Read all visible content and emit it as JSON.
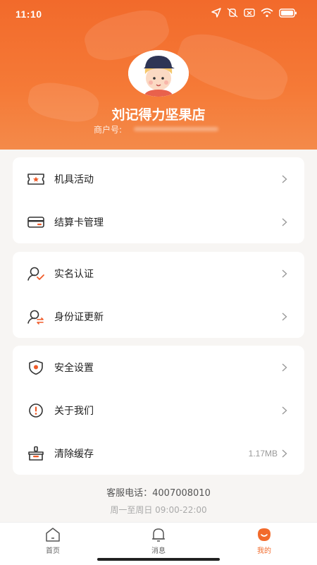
{
  "status_bar": {
    "time": "11:10",
    "icons": [
      "location-icon",
      "mute-icon",
      "sim-off-icon",
      "wifi-icon",
      "battery-icon"
    ]
  },
  "profile": {
    "name": "刘记得力坚果店",
    "merchant_id_label": "商户号:"
  },
  "menu_groups": [
    {
      "items": [
        {
          "label": "机具活动",
          "icon": "ticket-icon"
        },
        {
          "label": "结算卡管理",
          "icon": "card-icon"
        }
      ]
    },
    {
      "items": [
        {
          "label": "实名认证",
          "icon": "user-verify-icon"
        },
        {
          "label": "身份证更新",
          "icon": "user-update-icon"
        }
      ]
    },
    {
      "items": [
        {
          "label": "安全设置",
          "icon": "shield-icon"
        },
        {
          "label": "关于我们",
          "icon": "info-icon"
        },
        {
          "label": "清除缓存",
          "icon": "broom-icon",
          "value": "1.17MB"
        }
      ]
    }
  ],
  "service": {
    "phone": "客服电话：4007008010",
    "hours": "周一至周日 09:00-22:00"
  },
  "tabbar": {
    "tabs": [
      {
        "label": "首页",
        "icon": "home-icon"
      },
      {
        "label": "消息",
        "icon": "bell-icon"
      },
      {
        "label": "我的",
        "icon": "me-icon",
        "active": true
      }
    ]
  },
  "colors": {
    "accent": "#f26a2b",
    "icon_orange": "#f05a28",
    "chevron": "#9a9a9a"
  }
}
